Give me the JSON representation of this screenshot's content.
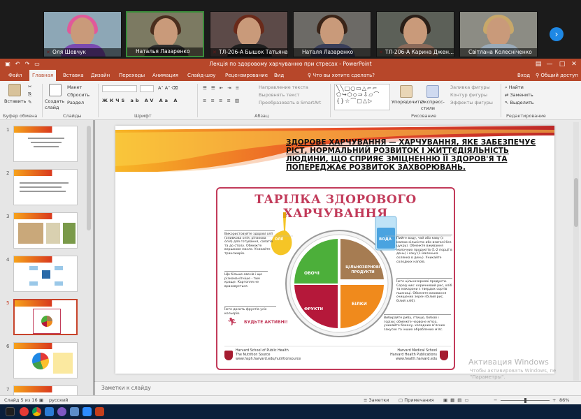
{
  "meeting": {
    "participants": [
      {
        "name": "Оля Шевчук"
      },
      {
        "name": "Наталья Лазаренко"
      },
      {
        "name": "ТЛ-206-А Бышок Татьяна"
      },
      {
        "name": "Наталя Лазаренко"
      },
      {
        "name": "ТЛ-206-А Карина Джен..."
      },
      {
        "name": "Світлана Колесніченко"
      }
    ],
    "next_icon": "chevron-right-icon"
  },
  "window": {
    "title": "Лекція по здоровому харчуванню при стресах - PowerPoint",
    "minimize": "—",
    "maximize": "□",
    "close": "✕"
  },
  "tabs": [
    "Файл",
    "Главная",
    "Вставка",
    "Дизайн",
    "Переходы",
    "Анимация",
    "Слайд-шоу",
    "Рецензирование",
    "Вид"
  ],
  "active_tab": "Главная",
  "tell_me": "Что вы хотите сделать?",
  "right_tabs": {
    "login": "Вход",
    "share": "Общий доступ"
  },
  "ribbon": {
    "groups": {
      "clipboard": "Буфер обмена",
      "slides": "Слайды",
      "font": "Шрифт",
      "paragraph": "Абзац",
      "drawing": "Рисование",
      "editing": "Редактирование"
    },
    "paste": "Вставить",
    "new_slide": "Создать слайд",
    "layout": "Макет",
    "reset": "Сбросить",
    "section": "Раздел",
    "text_direction": "Направление текста",
    "align_text": "Выровнять текст",
    "smartart": "Преобразовать в SmartArt",
    "arrange": "Упорядочить",
    "quick_styles": "Экспресс-стили",
    "fill": "Заливка фигуры",
    "outline": "Контур фигуры",
    "effects": "Эффекты фигуры",
    "find": "Найти",
    "replace": "Заменить",
    "select": "Выделить"
  },
  "thumbnails": [
    "1",
    "2",
    "3",
    "4",
    "5",
    "6",
    "7"
  ],
  "active_slide": 5,
  "slide": {
    "headline": "ЗДОРОВЕ ХАРЧУВАННЯ —  ХАРЧУВАННЯ, ЯКЕ ЗАБЕЗПЕЧУЄ РІСТ, НОРМАЛЬНИЙ РОЗВИТОК І ЖИТТЄДІЯЛЬНІСТЬ ЛЮДИНИ, ЩО СПРИЯЄ ЗМІЦНЕННЮ ЇЇ ЗДОРОВ'Я ТА ПОПЕРЕДЖАЄ РОЗВИТОК ЗАХВОРЮВАНЬ.",
    "plate_title": "ТАРІЛКА ЗДОРОВОГО ХАРЧУВАННЯ",
    "segments": {
      "vegetables": "ОВОЧІ",
      "grains": "ЦІЛЬНОЗЕРНОВІ ПРОДУКТИ",
      "fruits": "ФРУКТИ",
      "protein": "БІЛКИ",
      "oil": "ОЛІЇ",
      "water": "ВОДА"
    },
    "notes": {
      "oil_note": "Використовуйте здорові олії (оливкова олія, ріпакова олія) для готування, салатів та до столу. Обмежте вершкове масло. Уникайте трансжирів.",
      "veg_note": "Що більше овочів і що різноманітніше - тим краще. Картопля не враховується.",
      "fruit_note": "Їжте досить фруктів усіх кольорів.",
      "water_note": "Пийте воду, чай або каву (з малою кількістю або взагалі без цукру). Обмежте вживання молочних продуктів (1-2 порції в день) і соку (1 маленька склянка в день). Уникайте солодких напоїв.",
      "grain_note": "Їжте цільнозернові продукти. Серед них: коричневий рис, хліб та макарони з твердих сортів пшениці. Обмежте вживання очищених зерен (білий рис, білий хліб).",
      "protein_note": "Вибирайте рибу, птицю, бобові і горіхи; обмежте червоне м'ясо, уникайте бекону, холодних м'ясних закусок та інших оброблених м'яс."
    },
    "be_active": "БУДЬТЕ АКТИВНІ!",
    "harvard_left": [
      "Harvard School of Public Health",
      "The Nutrition Source",
      "www.hsph.harvard.edu/nutritionsource"
    ],
    "harvard_right": [
      "Harvard Medical School",
      "Harvard Health Publications",
      "www.health.harvard.edu"
    ]
  },
  "notes_placeholder": "Заметки к слайду",
  "status": {
    "slide_count": "Слайд 5 из 16",
    "language": "русский",
    "notes_btn": "Заметки",
    "comments_btn": "Примечания",
    "zoom": "86%",
    "zoom_fraction": 0.5
  },
  "watermark": {
    "line1": "Активация Windows",
    "line2": "Чтобы активировать Windows, пе",
    "line3": "\"Параметры\"."
  },
  "colors": {
    "accent": "#b7472a",
    "vegetables": "#4caf3a",
    "grains": "#a67c52",
    "fruits": "#b5183a",
    "protein": "#f08a1c",
    "plate_frame": "#c23b5a"
  }
}
